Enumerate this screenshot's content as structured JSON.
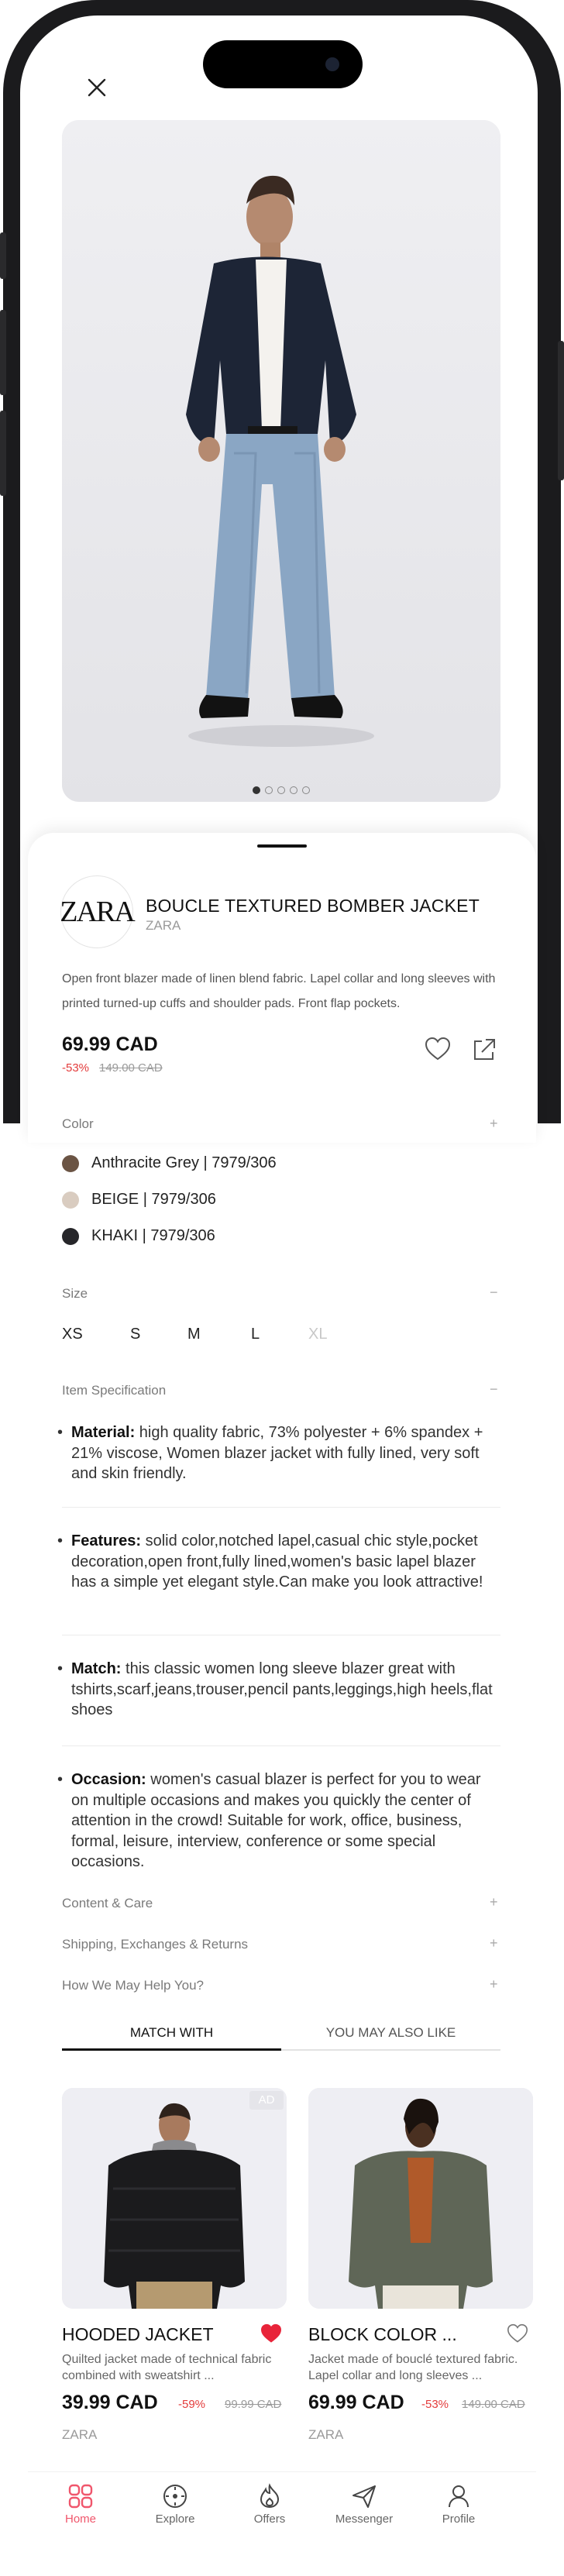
{
  "product": {
    "brand_logo": "ZARA",
    "title": "BOUCLE TEXTURED BOMBER JACKET",
    "brand": "ZARA",
    "description": "Open front blazer made of linen blend fabric. Lapel collar and long sleeves with printed turned-up cuffs and shoulder pads. Front flap pockets.",
    "price": "69.99 CAD",
    "discount": "-53%",
    "old_price": "149.00 CAD",
    "images_total": 5,
    "active_image": 0
  },
  "sections": {
    "color": {
      "label": "Color",
      "toggle": "+"
    },
    "size": {
      "label": "Size",
      "toggle": "−"
    },
    "spec": {
      "label": "Item Specification",
      "toggle": "−"
    },
    "content": {
      "label": "Content & Care",
      "toggle": "+"
    },
    "shipping": {
      "label": "Shipping, Exchanges & Returns",
      "toggle": "+"
    },
    "help": {
      "label": "How We  May Help You?",
      "toggle": "+"
    }
  },
  "colors": [
    {
      "label": "Anthracite Grey | 7979/306",
      "hex": "#6b5444"
    },
    {
      "label": "BEIGE | 7979/306",
      "hex": "#d9ccc0"
    },
    {
      "label": "KHAKI | 7979/306",
      "hex": "#26262a"
    }
  ],
  "sizes": [
    {
      "label": "XS",
      "available": true
    },
    {
      "label": "S",
      "available": true
    },
    {
      "label": "M",
      "available": true
    },
    {
      "label": "L",
      "available": true
    },
    {
      "label": "XL",
      "available": false
    }
  ],
  "specs": [
    {
      "key": "Material:",
      "text": " high quality fabric, 73% polyester + 6% spandex + 21% viscose, Women blazer jacket with fully lined, very soft and skin friendly."
    },
    {
      "key": "Features:",
      "text": " solid color,notched lapel,casual chic style,pocket decoration,open front,fully lined,women's basic lapel blazer has a simple yet elegant style.Can make you look attractive!"
    },
    {
      "key": "Match:",
      "text": " this classic women long sleeve blazer great with tshirts,scarf,jeans,trouser,pencil pants,leggings,high heels,flat shoes"
    },
    {
      "key": "Occasion:",
      "text": " women's casual blazer is perfect for you to wear on multiple occasions and makes you quickly the center of attention in the crowd! Suitable for work, office, business, formal, leisure, interview, conference or some special occasions."
    }
  ],
  "tabs": [
    {
      "label": "MATCH WITH",
      "active": true
    },
    {
      "label": "YOU MAY ALSO LIKE",
      "active": false
    }
  ],
  "cards": [
    {
      "ad": "AD",
      "title": "HOODED JACKET",
      "desc": "Quilted jacket made of technical fabric combined with sweatshirt ...",
      "price": "39.99 CAD",
      "discount": "-59%",
      "old_price": "99.99 CAD",
      "brand": "ZARA",
      "favorited": true
    },
    {
      "ad": "",
      "title": "BLOCK COLOR ...",
      "desc": "Jacket made of bouclé textured fabric. Lapel collar and long sleeves ...",
      "price": "69.99 CAD",
      "discount": "-53%",
      "old_price": "149.00 CAD",
      "brand": "ZARA",
      "favorited": false
    }
  ],
  "nav": [
    {
      "label": "Home",
      "icon": "home-grid-icon",
      "active": true
    },
    {
      "label": "Explore",
      "icon": "compass-icon",
      "active": false
    },
    {
      "label": "Offers",
      "icon": "flame-icon",
      "active": false
    },
    {
      "label": "Messenger",
      "icon": "send-icon",
      "active": false
    },
    {
      "label": "Profile",
      "icon": "user-icon",
      "active": false
    }
  ],
  "colors_ui": {
    "accent": "#f0566c",
    "sale": "#e33b3b",
    "favorite": "#e8243a"
  }
}
